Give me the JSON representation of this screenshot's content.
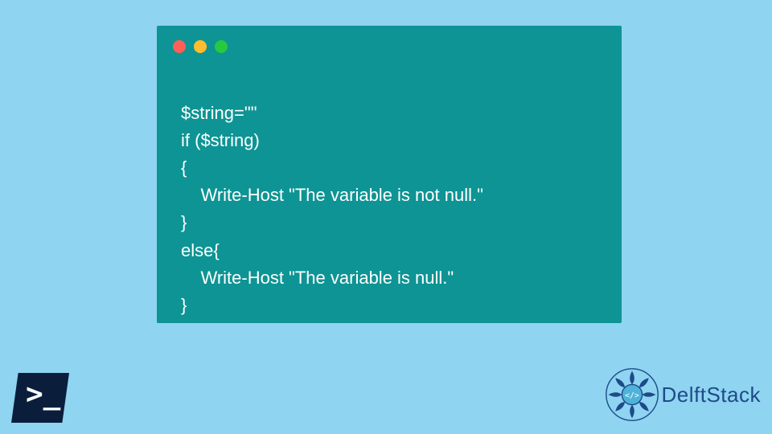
{
  "code": {
    "lines": [
      "$string=\"\"",
      "if ($string)",
      "{",
      "    Write-Host \"The variable is not null.\"",
      "}",
      "else{",
      "    Write-Host \"The variable is null.\"",
      "}"
    ]
  },
  "logo": {
    "brand": "DelftStack",
    "ps_symbol": ">_"
  },
  "colors": {
    "background": "#8fd4f0",
    "window": "#0e9494",
    "code_text": "#ffffff",
    "ps_bg": "#0a1e3c",
    "brand": "#1e4a8a"
  }
}
